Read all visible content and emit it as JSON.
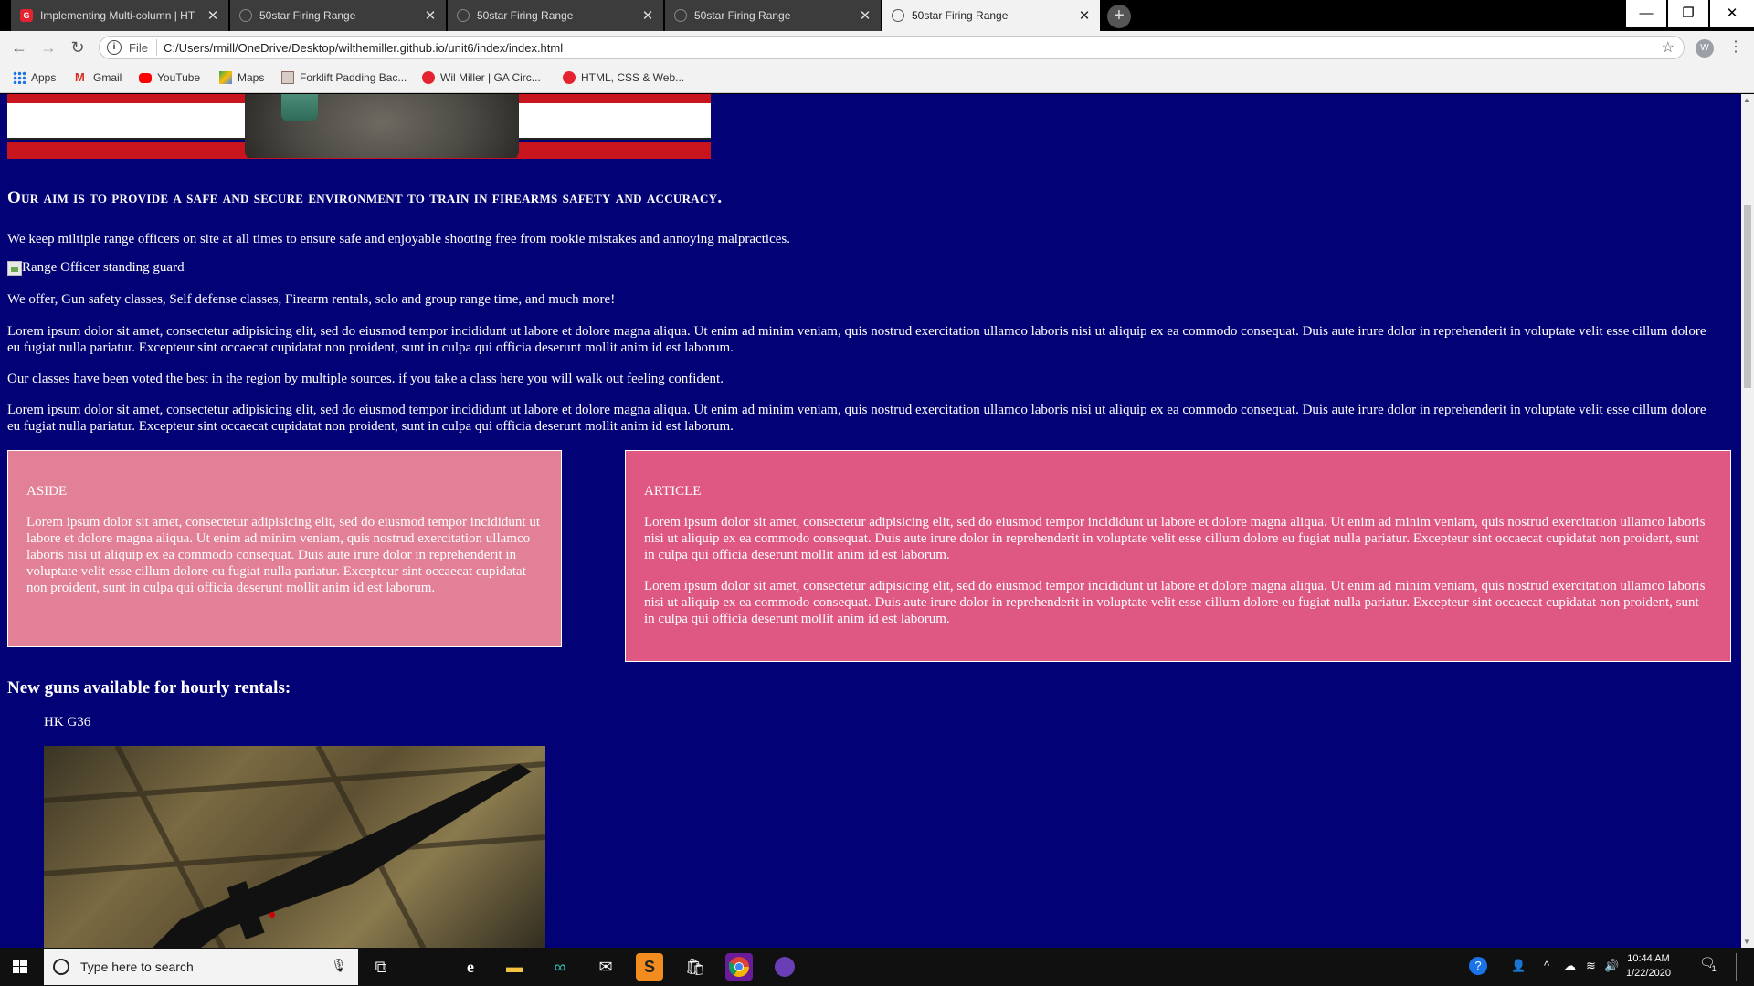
{
  "browser": {
    "tabs": [
      {
        "title": "Implementing Multi-column | HT",
        "icon": "ga-icon"
      },
      {
        "title": "50star Firing Range",
        "icon": "globe-icon"
      },
      {
        "title": "50star Firing Range",
        "icon": "globe-icon"
      },
      {
        "title": "50star Firing Range",
        "icon": "globe-icon"
      },
      {
        "title": "50star Firing Range",
        "icon": "globe-icon",
        "active": true
      }
    ],
    "address": {
      "scheme": "File",
      "url": "C:/Users/rmill/OneDrive/Desktop/wilthemiller.github.io/unit6/index/index.html"
    },
    "profile_initial": "W",
    "bookmarks": [
      {
        "label": "Apps",
        "icon": "apps-grid-icon",
        "color": "#1a73e8"
      },
      {
        "label": "Gmail",
        "icon": "gmail-icon",
        "color": "#d93025"
      },
      {
        "label": "YouTube",
        "icon": "youtube-icon",
        "color": "#ff0000"
      },
      {
        "label": "Maps",
        "icon": "maps-icon",
        "color": "#34a853"
      },
      {
        "label": "Forklift Padding Bac...",
        "icon": "page-icon",
        "color": "#8d6e63"
      },
      {
        "label": "Wil Miller | GA Circ...",
        "icon": "ga-icon",
        "color": "#e3232f"
      },
      {
        "label": "HTML, CSS & Web...",
        "icon": "ga-icon",
        "color": "#e3232f"
      }
    ]
  },
  "page": {
    "background": "#020276",
    "heading": "Our aim is to provide a safe and secure environment to train in firearms safety and accuracy.",
    "para_officers": "We keep miltiple range officers on site at all times to ensure safe and enjoyable shooting free from rookie mistakes and annoying malpractices.",
    "image_alt": "Range Officer standing guard",
    "para_offer": "We offer, Gun safety classes, Self defense classes, Firearm rentals, solo and group range time, and much more!",
    "lorem_1": "Lorem ipsum dolor sit amet, consectetur adipisicing elit, sed do eiusmod tempor incididunt ut labore et dolore magna aliqua. Ut enim ad minim veniam, quis nostrud exercitation ullamco laboris nisi ut aliquip ex ea commodo consequat. Duis aute irure dolor in reprehenderit in voluptate velit esse cillum dolore eu fugiat nulla pariatur. Excepteur sint occaecat cupidatat non proident, sunt in culpa qui officia deserunt mollit anim id est laborum.",
    "para_classes": "Our classes have been voted the best in the region by multiple sources. if you take a class here you will walk out feeling confident.",
    "lorem_2": "Lorem ipsum dolor sit amet, consectetur adipisicing elit, sed do eiusmod tempor incididunt ut labore et dolore magna aliqua. Ut enim ad minim veniam, quis nostrud exercitation ullamco laboris nisi ut aliquip ex ea commodo consequat. Duis aute irure dolor in reprehenderit in voluptate velit esse cillum dolore eu fugiat nulla pariatur. Excepteur sint occaecat cupidatat non proident, sunt in culpa qui officia deserunt mollit anim id est laborum.",
    "aside": {
      "title": "ASIDE",
      "text": "Lorem ipsum dolor sit amet, consectetur adipisicing elit, sed do eiusmod tempor incididunt ut labore et dolore magna aliqua. Ut enim ad minim veniam, quis nostrud exercitation ullamco laboris nisi ut aliquip ex ea commodo consequat. Duis aute irure dolor in reprehenderit in voluptate velit esse cillum dolore eu fugiat nulla pariatur. Excepteur sint occaecat cupidatat non proident, sunt in culpa qui officia deserunt mollit anim id est laborum.",
      "color": "#e28098"
    },
    "article": {
      "title": "ARTICLE",
      "text_1": "Lorem ipsum dolor sit amet, consectetur adipisicing elit, sed do eiusmod tempor incididunt ut labore et dolore magna aliqua. Ut enim ad minim veniam, quis nostrud exercitation ullamco laboris nisi ut aliquip ex ea commodo consequat. Duis aute irure dolor in reprehenderit in voluptate velit esse cillum dolore eu fugiat nulla pariatur. Excepteur sint occaecat cupidatat non proident, sunt in culpa qui officia deserunt mollit anim id est laborum.",
      "text_2": "Lorem ipsum dolor sit amet, consectetur adipisicing elit, sed do eiusmod tempor incididunt ut labore et dolore magna aliqua. Ut enim ad minim veniam, quis nostrud exercitation ullamco laboris nisi ut aliquip ex ea commodo consequat. Duis aute irure dolor in reprehenderit in voluptate velit esse cillum dolore eu fugiat nulla pariatur. Excepteur sint occaecat cupidatat non proident, sunt in culpa qui officia deserunt mollit anim id est laborum.",
      "color": "#de5883"
    },
    "rentals_title": "New guns available for hourly rentals:",
    "gun_name": "HK G36"
  },
  "taskbar": {
    "search_placeholder": "Type here to search",
    "time": "10:44 AM",
    "date": "1/22/2020",
    "notification_count": "1"
  }
}
